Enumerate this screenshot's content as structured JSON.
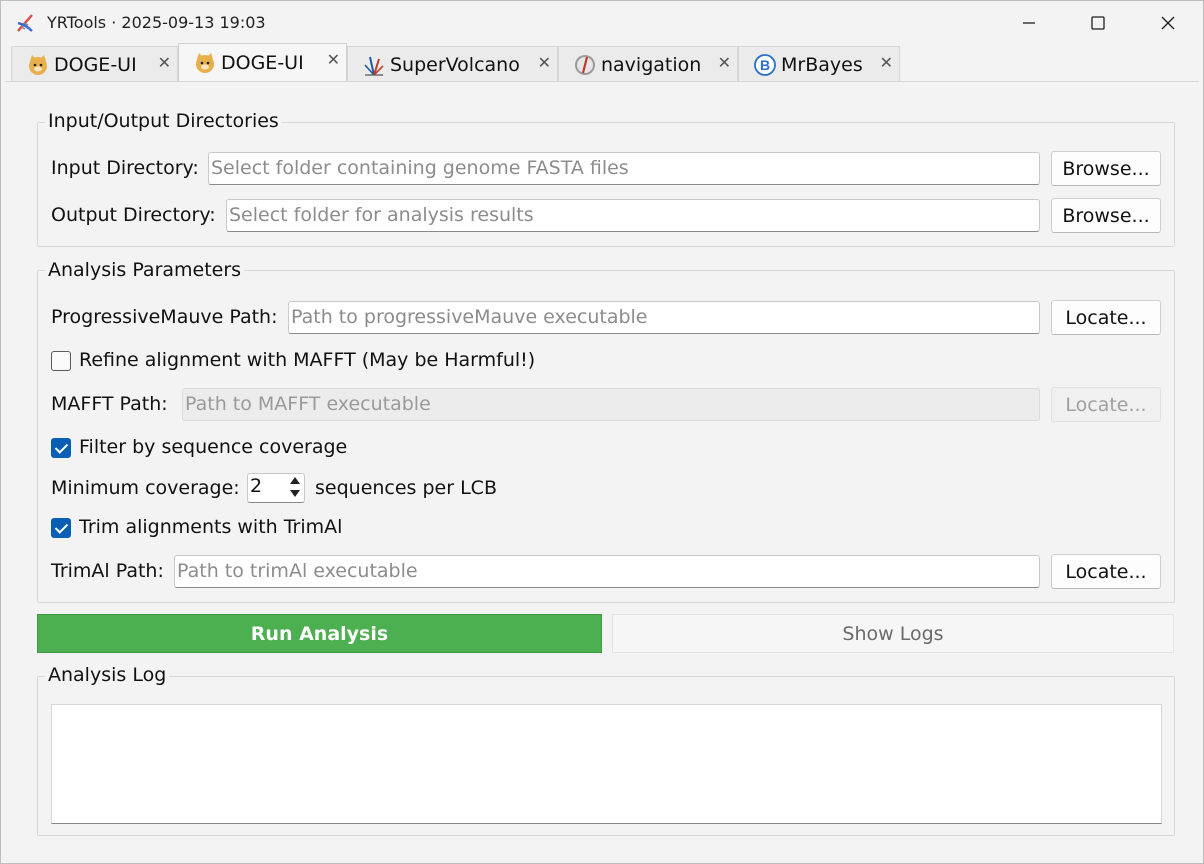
{
  "window": {
    "title": "YRTools · 2025-09-13 19:03",
    "min_glyph": "—",
    "max_glyph": "☐",
    "close_glyph": "✕"
  },
  "tabs": [
    {
      "label": "DOGE-UI",
      "icon": "doge-icon",
      "active": false
    },
    {
      "label": "DOGE-UI",
      "icon": "doge-icon",
      "active": true
    },
    {
      "label": "SuperVolcano",
      "icon": "volcano-icon",
      "active": false
    },
    {
      "label": "navigation",
      "icon": "compass-icon",
      "active": false
    },
    {
      "label": "MrBayes",
      "icon": "b-circle-icon",
      "active": false
    }
  ],
  "tab_close_glyph": "✕",
  "io_group": {
    "title": "Input/Output Directories",
    "input_label": "Input Directory:",
    "input_placeholder": "Select folder containing genome FASTA files",
    "output_label": "Output Directory:",
    "output_placeholder": "Select folder for analysis results",
    "browse_label": "Browse..."
  },
  "params_group": {
    "title": "Analysis Parameters",
    "mauve_label": "ProgressiveMauve Path:",
    "mauve_placeholder": "Path to progressiveMauve executable",
    "locate_label": "Locate...",
    "mafft_checkbox_label": "Refine alignment with MAFFT (May be Harmful!)",
    "mafft_checked": false,
    "mafft_label": "MAFFT Path:",
    "mafft_placeholder": "Path to MAFFT executable",
    "filter_checkbox_label": "Filter by sequence coverage",
    "filter_checked": true,
    "min_coverage_label": "Minimum coverage:",
    "min_coverage_value": "2",
    "min_coverage_suffix": "sequences per LCB",
    "trim_checkbox_label": "Trim alignments with TrimAl",
    "trim_checked": true,
    "trimal_label": "TrimAl Path:",
    "trimal_placeholder": "Path to trimAl executable"
  },
  "actions": {
    "run_label": "Run Analysis",
    "logs_label": "Show Logs"
  },
  "log_group": {
    "title": "Analysis Log",
    "content": ""
  }
}
